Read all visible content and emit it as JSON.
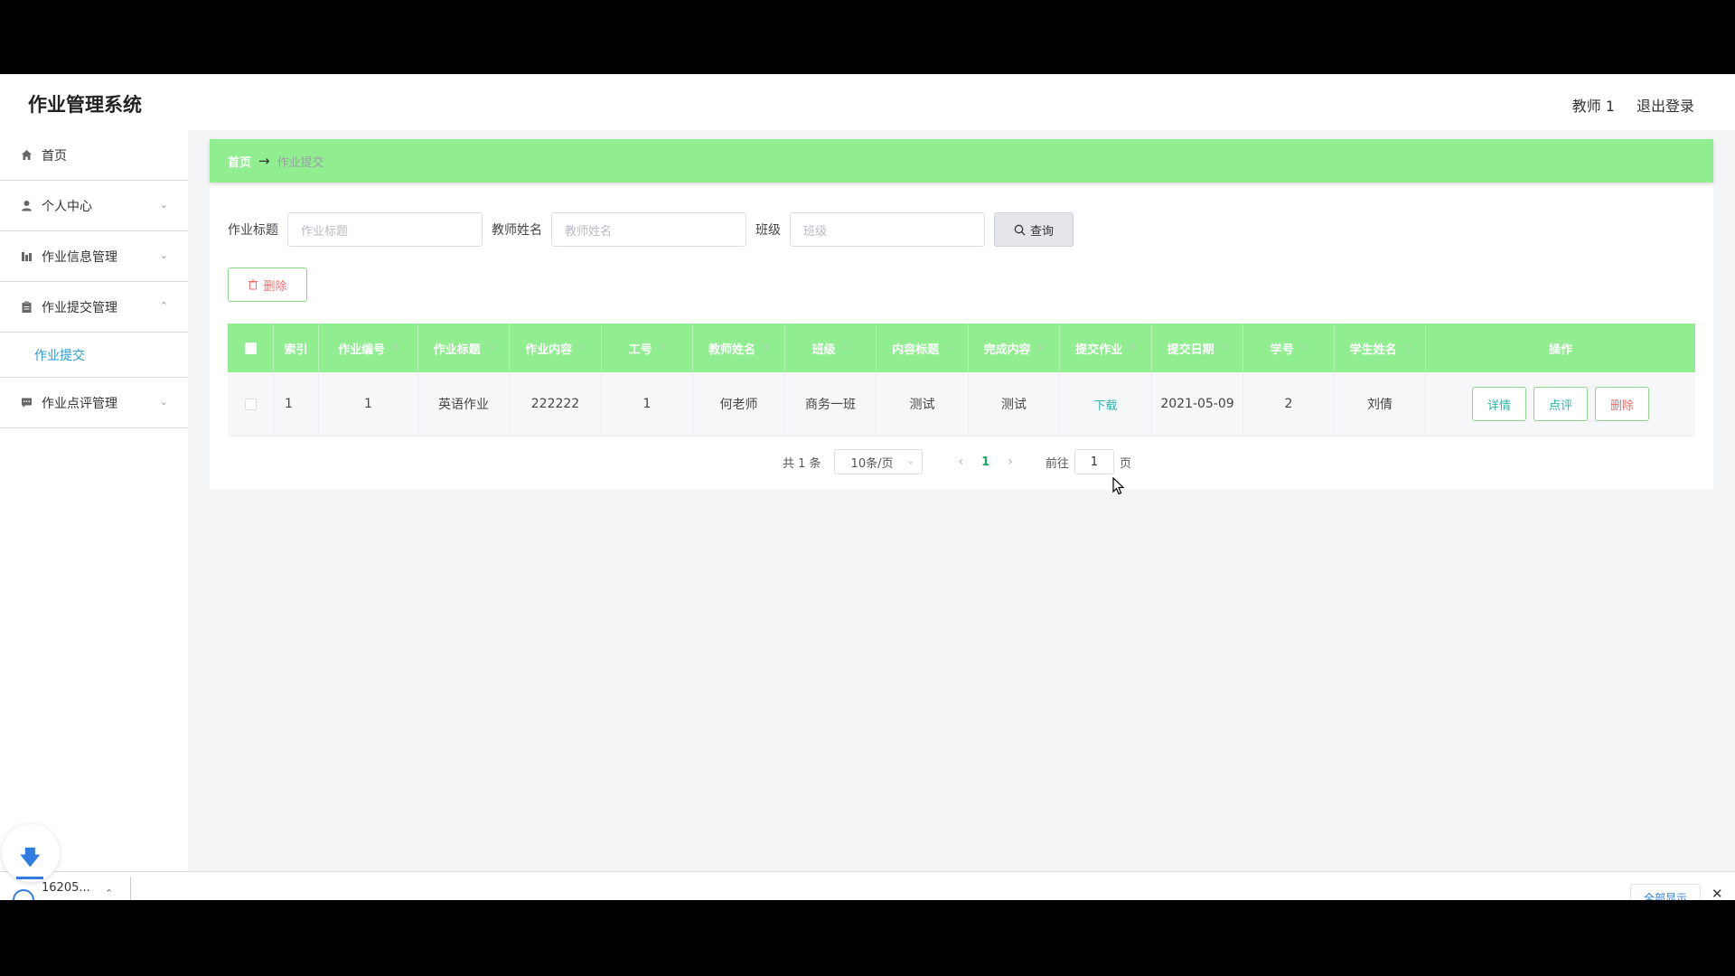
{
  "app": {
    "title": "作业管理系统"
  },
  "header": {
    "user": "教师 1",
    "logout": "退出登录"
  },
  "sidebar": {
    "items": [
      {
        "label": "首页",
        "icon": "home-icon"
      },
      {
        "label": "个人中心",
        "icon": "user-icon"
      },
      {
        "label": "作业信息管理",
        "icon": "chart-icon"
      },
      {
        "label": "作业提交管理",
        "icon": "clipboard-icon"
      },
      {
        "label": "作业点评管理",
        "icon": "comment-icon"
      }
    ],
    "submenu": {
      "label": "作业提交"
    }
  },
  "breadcrumb": {
    "home": "首页",
    "arrow": "→",
    "current": "作业提交"
  },
  "search": {
    "title_label": "作业标题",
    "title_placeholder": "作业标题",
    "teacher_label": "教师姓名",
    "teacher_placeholder": "教师姓名",
    "class_label": "班级",
    "class_placeholder": "班级",
    "button": "查询"
  },
  "toolbar": {
    "delete": "删除"
  },
  "table": {
    "headers": [
      "索引",
      "作业编号",
      "作业标题",
      "作业内容",
      "工号",
      "教师姓名",
      "班级",
      "内容标题",
      "完成内容",
      "提交作业",
      "提交日期",
      "学号",
      "学生姓名",
      "操作"
    ],
    "rows": [
      {
        "index": "1",
        "hw_no": "1",
        "hw_title": "英语作业",
        "hw_content": "222222",
        "staff_no": "1",
        "teacher": "何老师",
        "class": "商务一班",
        "content_title": "测试",
        "done_content": "测试",
        "submit": "下载",
        "date": "2021-05-09",
        "student_no": "2",
        "student": "刘倩",
        "actions": {
          "detail": "详情",
          "review": "点评",
          "delete": "删除"
        }
      }
    ]
  },
  "pagination": {
    "total": "共 1 条",
    "page_size": "10条/页",
    "current": "1",
    "goto_label": "前往",
    "goto_value": "1",
    "page_unit": "页"
  },
  "download_bar": {
    "file": "16205...",
    "show_all": "全部显示"
  },
  "colors": {
    "accent_green": "#90ee90",
    "danger": "#f56c6c",
    "link": "#2bb5a8",
    "page_current": "#19a95c"
  }
}
